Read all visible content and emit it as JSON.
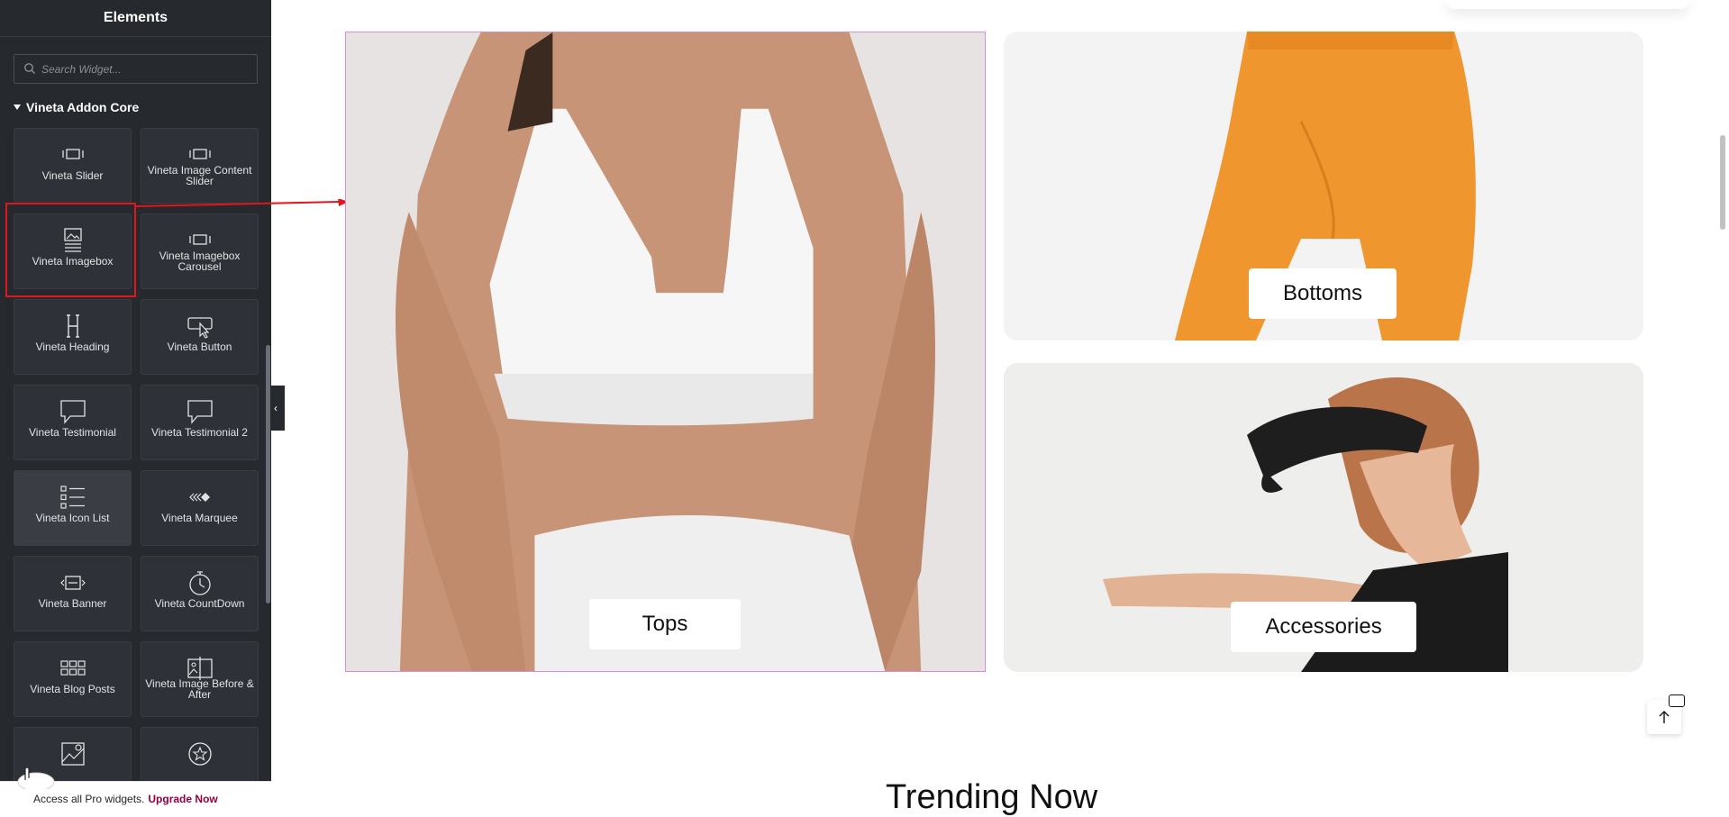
{
  "panel": {
    "title": "Elements",
    "search_placeholder": "Search Widget...",
    "category": "Vineta Addon Core",
    "widgets": [
      {
        "label": "Vineta Slider",
        "icon": "slider-icon"
      },
      {
        "label": "Vineta Image Content Slider",
        "icon": "slider-icon"
      },
      {
        "label": "Vineta Imagebox",
        "icon": "imagebox-icon"
      },
      {
        "label": "Vineta Imagebox Carousel",
        "icon": "slider-icon"
      },
      {
        "label": "Vineta Heading",
        "icon": "heading-icon"
      },
      {
        "label": "Vineta Button",
        "icon": "button-icon"
      },
      {
        "label": "Vineta Testimonial",
        "icon": "speech-bubble-icon"
      },
      {
        "label": "Vineta Testimonial 2",
        "icon": "speech-bubble-icon"
      },
      {
        "label": "Vineta Icon List",
        "icon": "icon-list-icon"
      },
      {
        "label": "Vineta Marquee",
        "icon": "marquee-icon"
      },
      {
        "label": "Vineta Banner",
        "icon": "banner-icon"
      },
      {
        "label": "Vineta CountDown",
        "icon": "stopwatch-icon"
      },
      {
        "label": "Vineta Blog Posts",
        "icon": "grid-icon"
      },
      {
        "label": "Vineta Image Before & After",
        "icon": "before-after-icon"
      },
      {
        "label": "",
        "icon": "image-map-icon"
      },
      {
        "label": "",
        "icon": "star-icon"
      }
    ],
    "promo_text": "Access all Pro widgets.",
    "promo_link": "Upgrade Now"
  },
  "canvas": {
    "categories": [
      {
        "label": "Tops"
      },
      {
        "label": "Bottoms"
      },
      {
        "label": "Accessories"
      }
    ],
    "section_title": "Trending Now"
  },
  "colors": {
    "panel_bg": "#26292e",
    "tile_bg": "#2e3137",
    "selection_red": "#e0161b",
    "promo_link": "#93003f",
    "selected_outline": "#d98be0",
    "shorts_orange": "#f0962f"
  }
}
